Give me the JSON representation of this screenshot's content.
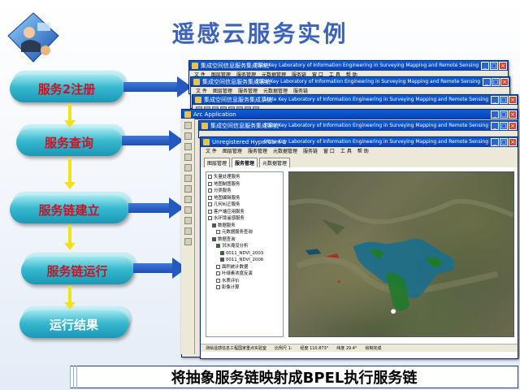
{
  "slide": {
    "title": "遥感云服务实例",
    "caption": "将抽象服务链映射成BPEL执行服务链"
  },
  "flow": {
    "steps": [
      {
        "label": "服务2注册"
      },
      {
        "label": "服务查询"
      },
      {
        "label": "服务链建立"
      },
      {
        "label": "服务链运行"
      },
      {
        "label": "运行结果"
      }
    ],
    "colors": {
      "pill": "#37b9cf",
      "pill_text": "#c0182a",
      "down_arrow": "#f2e21d",
      "right_arrow": "#2459bf"
    }
  },
  "windows": {
    "outer_title": "集成空间信息服务集成系统",
    "banner": "State Key Laboratory of Information Engineering in Surveying Mapping and Remote Sensing",
    "menu": [
      "文 件",
      "图层管理",
      "服务管理",
      "元数据管理",
      "服务链",
      "窗 口",
      "工 具",
      "帮 助"
    ],
    "arc_title": "Arc Application",
    "arc_menu": [
      "File",
      "Edit",
      "Model Control",
      "Run",
      "Search",
      "Window",
      "Help"
    ],
    "inner_title": "Unregistered HyperCam 2",
    "inner_menu": [
      "文 件",
      "图层管理",
      "服务管理",
      "元数据管理",
      "服务链",
      "窗 口",
      "工 具",
      "帮 助"
    ],
    "tabs": [
      "图层管理",
      "服务管理",
      "元数据管理"
    ],
    "tree": [
      {
        "label": "矢量处理服务",
        "checked": false
      },
      {
        "label": "地图制图服务",
        "checked": false
      },
      {
        "label": "分类服务",
        "checked": false
      },
      {
        "label": "地图编辑服务",
        "checked": false
      },
      {
        "label": "几何纠正服务",
        "checked": false
      },
      {
        "label": "客户端应用服务",
        "checked": false
      },
      {
        "label": "水环境遥感服务",
        "checked": false
      },
      {
        "label": "数据服务",
        "checked": true
      },
      {
        "label": "元数据服务查询",
        "checked": false
      },
      {
        "label": "数据查询",
        "checked": true
      },
      {
        "label": "洪水淹没分析",
        "checked": true
      },
      {
        "label": "0011_NDVI_2003",
        "checked": true
      },
      {
        "label": "0011_NDVI_2006",
        "checked": true
      },
      {
        "label": "面积统计数据",
        "checked": false
      },
      {
        "label": "叶绿素浓度反演",
        "checked": false
      },
      {
        "label": "水质评价",
        "checked": false
      },
      {
        "label": "影像计算",
        "checked": false
      }
    ],
    "status": [
      "测绘遥感信息工程国家重点实验室",
      "比例尺 1:",
      "经度 110.873°",
      "纬度 29.4°",
      "绘制完成"
    ],
    "map_colors": {
      "lake": "#1a6e8c",
      "green": "#1f7a2a",
      "terrain": "#6b6a4d"
    }
  }
}
